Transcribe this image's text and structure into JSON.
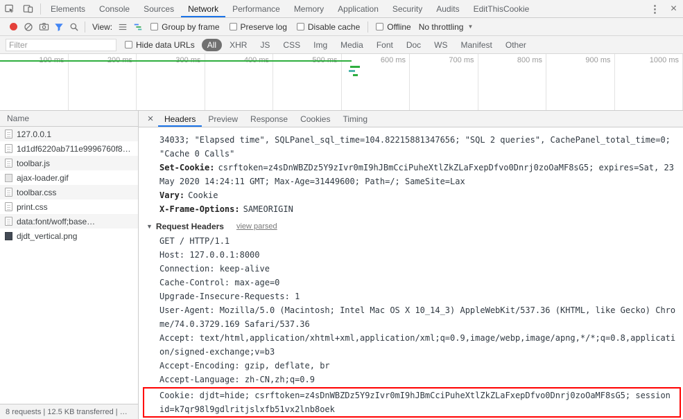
{
  "devtools": {
    "tabs": [
      "Elements",
      "Console",
      "Sources",
      "Network",
      "Performance",
      "Memory",
      "Application",
      "Security",
      "Audits",
      "EditThisCookie"
    ],
    "active_tab": "Network",
    "menu_icon": "⋮",
    "close_icon": "×"
  },
  "toolbar": {
    "view_label": "View:",
    "group_by_frame": "Group by frame",
    "preserve_log": "Preserve log",
    "disable_cache": "Disable cache",
    "offline": "Offline",
    "throttling": "No throttling",
    "throttling_caret": "▼"
  },
  "filter_bar": {
    "placeholder": "Filter",
    "hide_data_urls": "Hide data URLs",
    "pills": [
      "All",
      "XHR",
      "JS",
      "CSS",
      "Img",
      "Media",
      "Font",
      "Doc",
      "WS",
      "Manifest",
      "Other"
    ],
    "active_pill": "All"
  },
  "timeline": {
    "ticks": [
      "100 ms",
      "200 ms",
      "300 ms",
      "400 ms",
      "500 ms",
      "600 ms",
      "700 ms",
      "800 ms",
      "900 ms",
      "1000 ms"
    ]
  },
  "requests": {
    "column_header": "Name",
    "rows": [
      {
        "name": "127.0.0.1",
        "icon": "document-icon"
      },
      {
        "name": "1d1df6220ab711e9996760f8…",
        "icon": "document-icon"
      },
      {
        "name": "toolbar.js",
        "icon": "script-icon"
      },
      {
        "name": "ajax-loader.gif",
        "icon": "image-icon"
      },
      {
        "name": "toolbar.css",
        "icon": "stylesheet-icon"
      },
      {
        "name": "print.css",
        "icon": "stylesheet-icon"
      },
      {
        "name": "data:font/woff;base…",
        "icon": "font-icon"
      },
      {
        "name": "djdt_vertical.png",
        "icon": "image-icon"
      }
    ]
  },
  "details": {
    "close_icon": "×",
    "tabs": [
      "Headers",
      "Preview",
      "Response",
      "Cookies",
      "Timing"
    ],
    "active_tab": "Headers"
  },
  "headers_pane": {
    "overflow_value": "34033; \"Elapsed time\", SQLPanel_sql_time=104.82215881347656; \"SQL 2 queries\", CachePanel_total_time=0; \"Cache 0 Calls\"",
    "response_headers": [
      {
        "key": "Set-Cookie:",
        "value": "csrftoken=z4sDnWBZDz5Y9zIvr0mI9hJBmCciPuheXtlZkZLaFxepDfvo0Dnrj0zoOaMF8sG5; expires=Sat, 23 May 2020 14:24:11 GMT; Max-Age=31449600; Path=/; SameSite=Lax"
      },
      {
        "key": "Vary:",
        "value": "Cookie"
      },
      {
        "key": "X-Frame-Options:",
        "value": "SAMEORIGIN"
      }
    ],
    "request_headers_label": "Request Headers",
    "disclosure": "▼",
    "view_parsed_label": "view parsed",
    "raw_request_lines": [
      "GET / HTTP/1.1",
      "Host: 127.0.0.1:8000",
      "Connection: keep-alive",
      "Cache-Control: max-age=0",
      "Upgrade-Insecure-Requests: 1",
      "User-Agent: Mozilla/5.0 (Macintosh; Intel Mac OS X 10_14_3) AppleWebKit/537.36 (KHTML, like Gecko) Chrome/74.0.3729.169 Safari/537.36",
      "Accept: text/html,application/xhtml+xml,application/xml;q=0.9,image/webp,image/apng,*/*;q=0.8,application/signed-exchange;v=b3",
      "Accept-Encoding: gzip, deflate, br",
      "Accept-Language: zh-CN,zh;q=0.9"
    ],
    "highlighted_cookie_line": "Cookie: djdt=hide; csrftoken=z4sDnWBZDz5Y9zIvr0mI9hJBmCciPuheXtlZkZLaFxepDfvo0Dnrj0zoOaMF8sG5; sessionid=k7qr98l9gdlritjslxfb51vx2lnb8oek"
  },
  "status_bar": {
    "summary": "8 requests | 12.5 KB transferred | …"
  },
  "colors": {
    "accent_blue": "#1a73e8",
    "record_red": "#e4413a",
    "filter_active_blue": "#4285f4",
    "timeline_green": "#2eae3e",
    "highlight_red": "#ff0000",
    "pill_active_bg": "#707070"
  }
}
